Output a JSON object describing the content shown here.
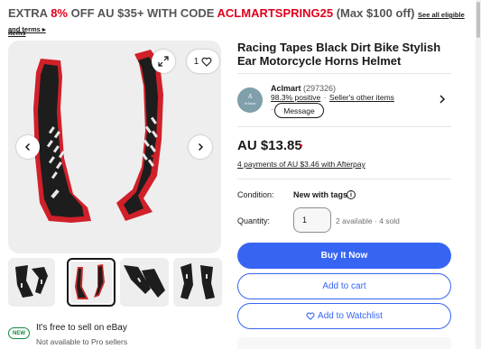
{
  "promo": {
    "prefix": "EXTRA ",
    "percent": "8%",
    "middle": " OFF AU $35+ WITH CODE ",
    "code": "ACLMARTSPRING25",
    "suffix": " (Max $100 off)",
    "link_part1": "See all eligible items",
    "link_part2": "and terms ▸"
  },
  "gallery": {
    "fav_count": "1",
    "icons": {
      "prev": "chevron-left-icon",
      "next": "chevron-right-icon",
      "expand": "expand-icon",
      "favorite": "heart-icon"
    }
  },
  "thumbnails": [
    "thumb-1",
    "thumb-2",
    "thumb-3",
    "thumb-4"
  ],
  "sell": {
    "badge": "NEW",
    "title": "It's free to sell on eBay",
    "subtitle": "Not available to Pro sellers"
  },
  "item": {
    "title": "Racing Tapes Black Dirt Bike Stylish Ear Motorcycle Horns Helmet",
    "price": "AU $13.85",
    "afterpay": "4 payments of AU $3.46 with Afterpay",
    "condition_label": "Condition:",
    "condition_value": "New with tags",
    "quantity_label": "Quantity:",
    "quantity_value": "1",
    "availability": "2 available · 4 sold"
  },
  "seller": {
    "name": "Aclmart",
    "count": "(297326)",
    "positive": "98.3% positive",
    "separator": "·",
    "other_items": "Seller's other items",
    "message": "Message",
    "logo_text": "Aclmart"
  },
  "buttons": {
    "buy": "Buy It Now",
    "cart": "Add to cart",
    "watch": "Add to Watchlist"
  },
  "colors": {
    "accent": "#3665f3",
    "promo_red": "#e0001b",
    "new_green": "#0f8b3e"
  }
}
